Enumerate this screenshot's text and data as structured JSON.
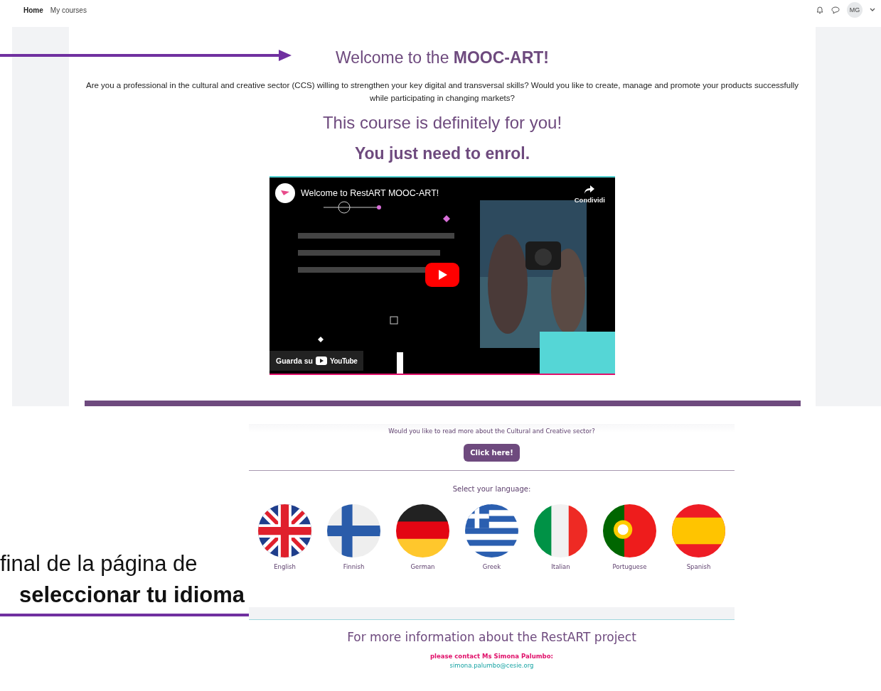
{
  "nav": {
    "links": [
      {
        "label": "Home",
        "selected": true
      },
      {
        "label": "My courses",
        "selected": false
      }
    ],
    "avatar": "MG"
  },
  "course": {
    "title": "Welcome to the **MOOC-ART!**",
    "intro": "Are you a professional in the cultural and creative sector (CCS) willing to strengthen your key digital and transversal skills? Would you like to create, manage and promote your products successfully while participating in changing markets?",
    "tagline": "This course is definitely for you!",
    "call": "You just need to enrol.",
    "video": {
      "title": "Welcome to RestART MOOC-ART!",
      "share": "Condividi",
      "watch": "Guarda su",
      "brand": "YouTube"
    }
  },
  "more": {
    "question": "Would you like to read more about the Cultural and Creative sector?",
    "button": "Click here!"
  },
  "languages": {
    "prompt": "Select your language:",
    "items": [
      {
        "label": "English"
      },
      {
        "label": "Finnish"
      },
      {
        "label": "German"
      },
      {
        "label": "Greek"
      },
      {
        "label": "Italian"
      },
      {
        "label": "Portuguese"
      },
      {
        "label": "Spanish"
      }
    ]
  },
  "side_note": {
    "lines": [
      {
        "text": "final de la página de",
        "bold": false
      },
      {
        "text": "seleccionar tu idioma",
        "bold": true
      }
    ]
  },
  "footer": {
    "heading": "For more information about the RestART project",
    "contact": "please contact Ms Simona Palumbo:",
    "email": "simona.palumbo@cesie.org"
  }
}
